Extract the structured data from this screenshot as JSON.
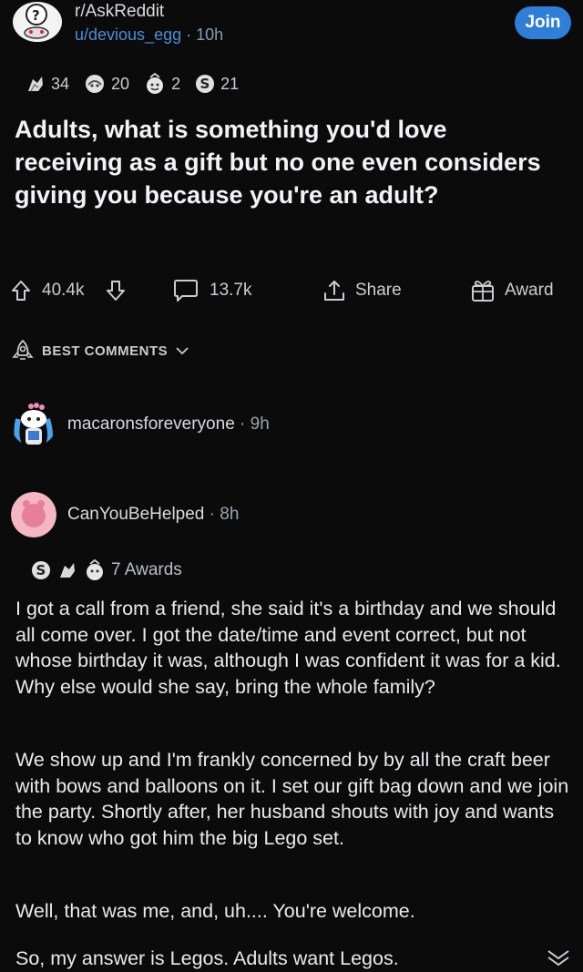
{
  "post": {
    "subreddit": "r/AskReddit",
    "author": "u/devious_egg",
    "separator": "·",
    "age": "10h",
    "join_label": "Join",
    "awards": [
      {
        "icon": "gold-medal-icon",
        "count": "34"
      },
      {
        "icon": "face-award-icon",
        "count": "20"
      },
      {
        "icon": "wholesome-award-icon",
        "count": "2"
      },
      {
        "icon": "coin-award-icon",
        "count": "21"
      }
    ],
    "title": "Adults, what is something you'd love receiving as a gift but no one even considers giving you because you're an adult?",
    "upvotes": "40.4k",
    "comments_count": "13.7k",
    "share_label": "Share",
    "award_label": "Award"
  },
  "sort": {
    "label": "BEST COMMENTS"
  },
  "comments": [
    {
      "username": "macaronsforeveryone",
      "separator": "·",
      "age": "9h"
    },
    {
      "username": "CanYouBeHelped",
      "separator": "·",
      "age": "8h",
      "awards_label": "7 Awards",
      "paragraphs": [
        "I got a call from a friend, she said it's a birthday and we should all come over. I got the date/time and event correct, but not whose birthday it was, although I was confident it was for a kid. Why else would she say, bring the whole family?",
        "We show up and I'm frankly concerned by by all the craft beer with bows and balloons on it. I set our gift bag down and we join the party. Shortly after, her husband shouts with joy and wants to know who got him the big Lego set.",
        "Well, that was me, and, uh.... You're welcome.",
        "So, my answer is Legos. Adults want Legos."
      ]
    }
  ],
  "colors": {
    "background": "#0b0b0b",
    "accent": "#2f7ed8",
    "link": "#4b8fd6"
  }
}
